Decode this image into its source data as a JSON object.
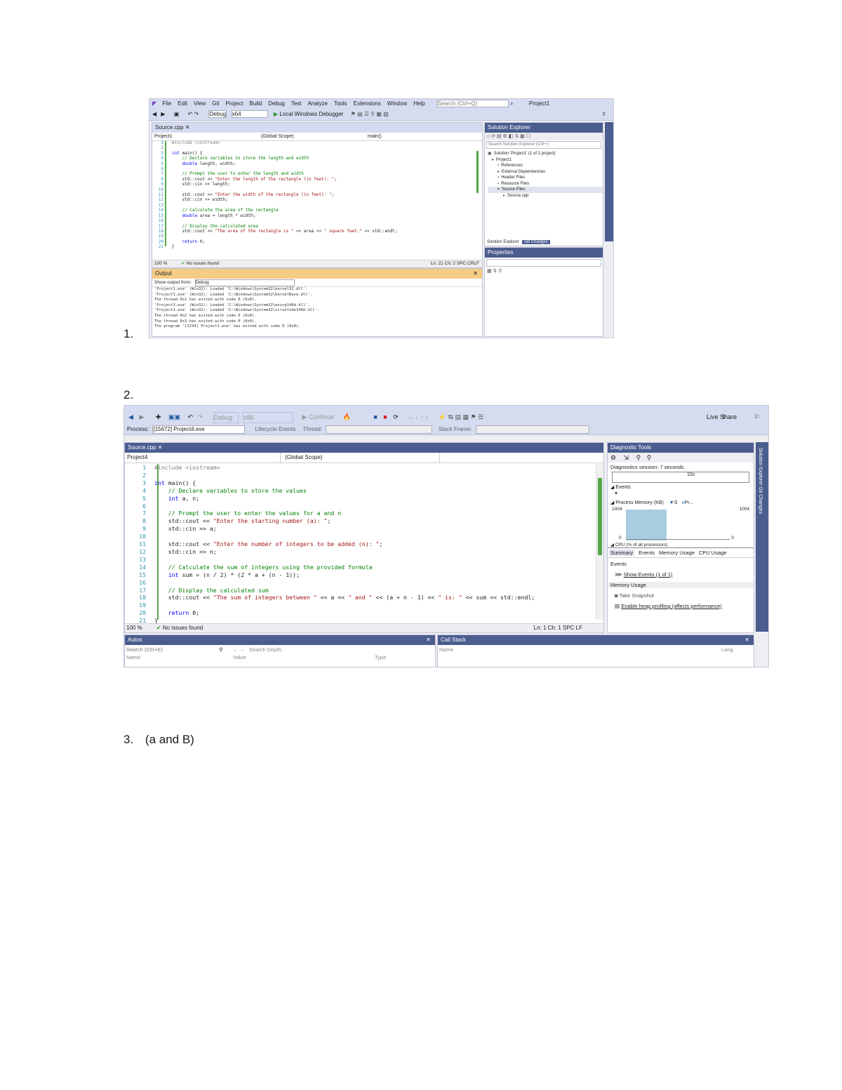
{
  "items": [
    {
      "label": "1."
    },
    {
      "label": "2."
    },
    {
      "label": "3.",
      "text": "(a and B)"
    }
  ],
  "shot1": {
    "menu": [
      "File",
      "Edit",
      "View",
      "Git",
      "Project",
      "Build",
      "Debug",
      "Test",
      "Analyze",
      "Tools",
      "Extensions",
      "Window",
      "Help"
    ],
    "search_placeholder": "Search (Ctrl+Q)",
    "project_name": "Project1",
    "config": "Debug",
    "platform": "x64",
    "run_label": "Local Windows Debugger",
    "code_tab": "Source.cpp",
    "nav_project": "Project1",
    "nav_scope": "(Global Scope)",
    "nav_func": "main()",
    "code_lines": [
      "#include <iostream>",
      "",
      "int main() {",
      "    // Declare variables to store the length and width",
      "    double length, width;",
      "",
      "    // Prompt the user to enter the length and width",
      "    std::cout << \"Enter the length of the rectangle (in feet): \";",
      "    std::cin >> length;",
      "",
      "    std::cout << \"Enter the width of the rectangle (in feet): \";",
      "    std::cin >> width;",
      "",
      "    // Calculate the area of the rectangle",
      "    double area = length * width;",
      "",
      "    // Display the calculated area",
      "    std::cout << \"The area of the rectangle is \" << area << \" square feet.\" << std::endl;",
      "",
      "    return 0;",
      "}"
    ],
    "zoom": "100 %",
    "issues": "No issues found",
    "position": "Ln: 21   Ch: 2   SPC   CRLF",
    "output_title": "Output",
    "output_from": "Show output from:",
    "output_source": "Debug",
    "output_lines": [
      "'Project1.exe' (Win32): Loaded 'C:\\Windows\\System32\\kernel32.dll'.",
      "'Project1.exe' (Win32): Loaded 'C:\\Windows\\System32\\KernelBase.dll'.",
      "The thread 0x1 has exited with code 0 (0x0).",
      "'Project1.exe' (Win32): Loaded 'C:\\Windows\\System32\\msvcp140d.dll'.",
      "'Project1.exe' (Win32): Loaded 'C:\\Windows\\System32\\vcruntime140d.dll'.",
      "The thread 0x2 has exited with code 0 (0x0).",
      "The thread 0x3 has exited with code 0 (0x0).",
      "The program '[1234] Project1.exe' has exited with code 0 (0x0)."
    ],
    "solution_title": "Solution Explorer",
    "solution_search": "Search Solution Explorer (Ctrl+;)",
    "solution_tree": [
      "Solution 'Project1' (1 of 1 project)",
      "Project1",
      "References",
      "External Dependencies",
      "Header Files",
      "Resource Files",
      "Source Files",
      "Source.cpp"
    ],
    "solution_tabs": [
      "Solution Explorer",
      "Git Changes"
    ],
    "properties_title": "Properties"
  },
  "shot2": {
    "config": "Debug",
    "platform": "x86",
    "continue_label": "Continue",
    "live_share": "Live Share",
    "process_label": "Process:",
    "process_value": "[15672] Project4.exe",
    "lifecycle": "Lifecycle Events",
    "thread": "Thread:",
    "stack_frame": "Stack Frame:",
    "code_tab": "Source.cpp",
    "nav_project": "Project4",
    "nav_scope": "(Global Scope)",
    "code_lines": [
      "#include <iostream>",
      "",
      "int main() {",
      "    // Declare variables to store the values",
      "    int a, n;",
      "",
      "    // Prompt the user to enter the values for a and n",
      "    std::cout << \"Enter the starting number (a): \";",
      "    std::cin >> a;",
      "",
      "    std::cout << \"Enter the number of integers to be added (n): \";",
      "    std::cin >> n;",
      "",
      "    // Calculate the sum of integers using the provided formula",
      "    int sum = (n / 2) * (2 * a + (n - 1));",
      "",
      "    // Display the calculated sum",
      "    std::cout << \"The sum of integers between \" << a << \" and \" << (a + n - 1) << \" is: \" << sum << std::endl;",
      "",
      "    return 0;",
      "}"
    ],
    "zoom": "100 %",
    "issues": "No issues found",
    "position": "Ln: 1   Ch: 1   SPC   LF",
    "diag_title": "Diagnostic Tools",
    "diag_session": "Diagnostics session: 7 seconds",
    "diag_tick": "10s",
    "events_label": "Events",
    "mem_label": "Process Memory (KB)",
    "mem_legend": "S",
    "mem_legend2": "Pr...",
    "mem_top": "1004",
    "mem_top_right": "1004",
    "mem_bottom": "0",
    "mem_bottom_right": "0",
    "cpu_label": "CPU (% of all processors)",
    "diag_tabs": [
      "Summary",
      "Events",
      "Memory Usage",
      "CPU Usage"
    ],
    "events_section": "Events",
    "show_events": "Show Events (1 of 1)",
    "memory_section": "Memory Usage",
    "take_snapshot": "Take Snapshot",
    "heap_profiling": "Enable heap profiling (affects performance)",
    "side_tabs": "Solution Explorer   Git Changes",
    "autos_title": "Autos",
    "autos_search": "Search (Ctrl+E)",
    "search_depth": "Search Depth:",
    "autos_cols": [
      "Name",
      "Value",
      "Type"
    ],
    "callstack_title": "Call Stack",
    "callstack_cols": [
      "Name",
      "Lang"
    ]
  },
  "colors": {
    "toolbar": "#d5dcf0",
    "panel_title": "#4b5d8f",
    "active_title": "#f5cc84",
    "keyword": "#0000ff",
    "comment": "#008000",
    "string": "#a31515",
    "memory_fill": "#a9cde0"
  }
}
